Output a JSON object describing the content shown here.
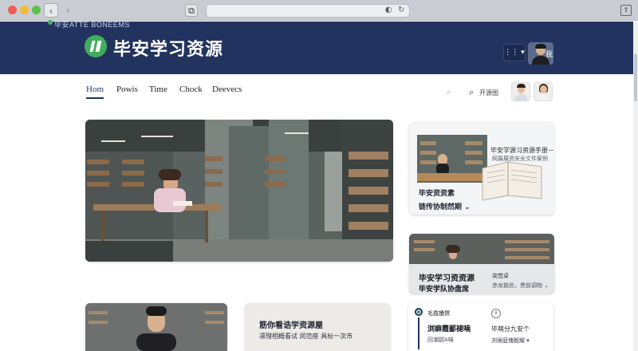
{
  "browser": {
    "back_glyph": "‹",
    "forward_glyph": "›",
    "apple_glyph": "",
    "tab_glyph": "⧉",
    "shield_glyph": "◐",
    "reload_glyph": "↻",
    "share_glyph": "⇪"
  },
  "header": {
    "top_strip": "毕安ATTE BONEEMS",
    "brand_title": "毕安学习资源",
    "menu_glyph": "⋮⋮ ▾",
    "avatar_text": "我"
  },
  "nav": {
    "tabs": [
      "Hom",
      "Powis",
      "Time",
      "Chock",
      "Deevecs"
    ],
    "search_faint_glyph": "⌕",
    "search_glyph": "⌕",
    "search_label": "开源图"
  },
  "card_a": {
    "title": "毕安学源习资源手册－",
    "subtitle": "网展展资安全文件案例",
    "heading1": "毕安资资素",
    "heading2": "链传协制然期 ⌄"
  },
  "card_b": {
    "heading1": "毕安学习资资源",
    "heading2": "毕安学队协盘席",
    "meta1": "突觉卓",
    "meta2": "赤龙挑优，贵前调物 ⌄"
  },
  "bottom": {
    "card2_title": "筋你看诰学资源屋",
    "card2_sub": "凛理相概看试 闵范座 具标一次市",
    "card3_top": "毛霞攮撰",
    "card3_title": "浏癖霞鄙褪喃",
    "card3_sub": "回潮甜A喵",
    "card3_icon": "⍟",
    "card3_title2": "毕萌分九安个",
    "card3_sub2": "浏境庭傀舰耀 ▾"
  },
  "colors": {
    "header_bg": "#233360",
    "brand_green": "#3fae5c",
    "nav_active": "#1f3b72"
  }
}
